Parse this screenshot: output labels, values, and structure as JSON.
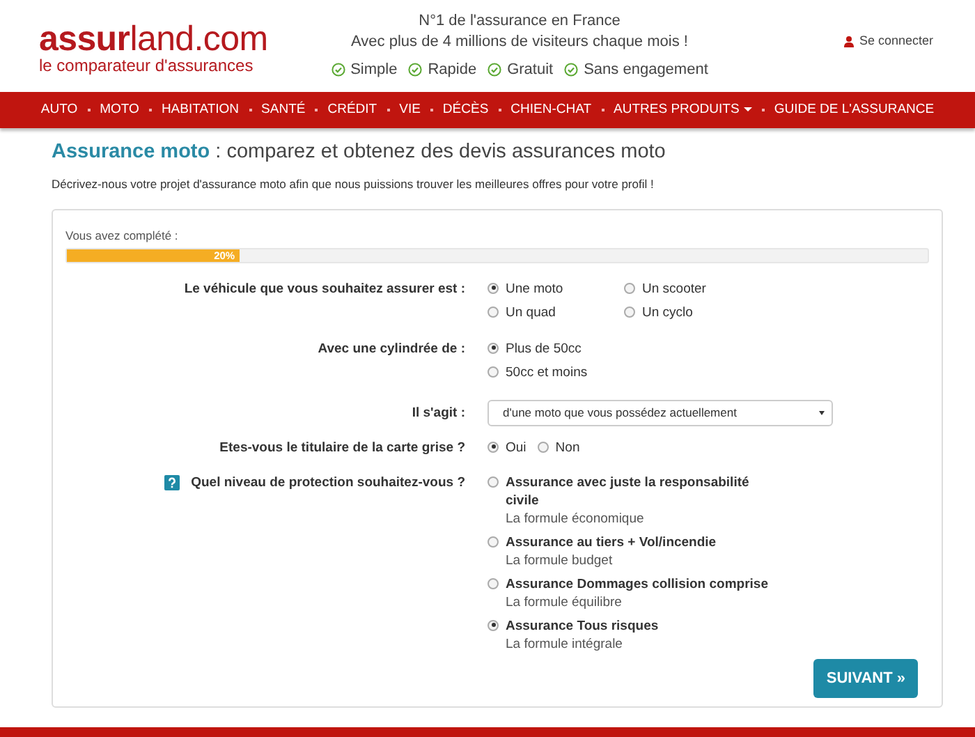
{
  "header": {
    "logo": "**assur**land.com",
    "tagline": "le comparateur d'assurances",
    "headline": "N°1 de l'assurance en France",
    "subline": "Avec plus de 4 millions de visiteurs chaque mois !",
    "features": [
      "Simple",
      "Rapide",
      "Gratuit",
      "Sans engagement"
    ],
    "login": "Se connecter"
  },
  "nav": [
    {
      "label": "AUTO",
      "dropdown": false
    },
    {
      "label": "MOTO",
      "dropdown": false
    },
    {
      "label": "HABITATION",
      "dropdown": false
    },
    {
      "label": "SANTÉ",
      "dropdown": false
    },
    {
      "label": "CRÉDIT",
      "dropdown": false
    },
    {
      "label": "VIE",
      "dropdown": false
    },
    {
      "label": "DÉCÈS",
      "dropdown": false
    },
    {
      "label": "CHIEN-CHAT",
      "dropdown": false
    },
    {
      "label": "AUTRES PRODUITS",
      "dropdown": true
    },
    {
      "label": "GUIDE DE L'ASSURANCE",
      "dropdown": false
    }
  ],
  "page": {
    "title": "**Assurance moto** : comparez et obtenez des devis assurances moto",
    "intro": "Décrivez-nous votre projet d'assurance moto afin que nous puissions trouver les meilleures offres pour votre profil !"
  },
  "progress": {
    "label": "Vous avez complété :",
    "level": 0.2,
    "reading": "20%"
  },
  "questions": [
    {
      "kind": "radio-grid",
      "label": "Le véhicule que vous souhaitez assurer est :",
      "help": false,
      "options": [
        {
          "label": "Une moto",
          "selected": true
        },
        {
          "label": "Un scooter",
          "selected": false
        },
        {
          "label": "Un quad",
          "selected": false
        },
        {
          "label": "Un cyclo",
          "selected": false
        }
      ]
    },
    {
      "kind": "radio-list",
      "label": "Avec une cylindrée de :",
      "help": false,
      "options": [
        {
          "label": "Plus de 50cc",
          "selected": true
        },
        {
          "label": "50cc et moins",
          "selected": false
        }
      ]
    },
    {
      "kind": "select",
      "label": "Il s'agit :",
      "help": false,
      "value": "d'une moto que vous possédez actuellement"
    },
    {
      "kind": "radio-inline",
      "label": "Etes-vous le titulaire de la carte grise ?",
      "help": false,
      "options": [
        {
          "label": "Oui",
          "selected": true
        },
        {
          "label": "Non",
          "selected": false
        }
      ]
    },
    {
      "kind": "radio-detail",
      "label": "Quel niveau de protection souhaitez-vous ?",
      "help": true,
      "options": [
        {
          "label": "Assurance avec juste la responsabilité civile",
          "description": "La formule économique",
          "selected": false
        },
        {
          "label": "Assurance au tiers + Vol/incendie",
          "description": "La formule budget",
          "selected": false
        },
        {
          "label": "Assurance Dommages collision comprise",
          "description": "La formule équilibre",
          "selected": false
        },
        {
          "label": "Assurance Tous risques",
          "description": "La formule intégrale",
          "selected": true
        }
      ]
    }
  ],
  "next_button": "SUIVANT »"
}
